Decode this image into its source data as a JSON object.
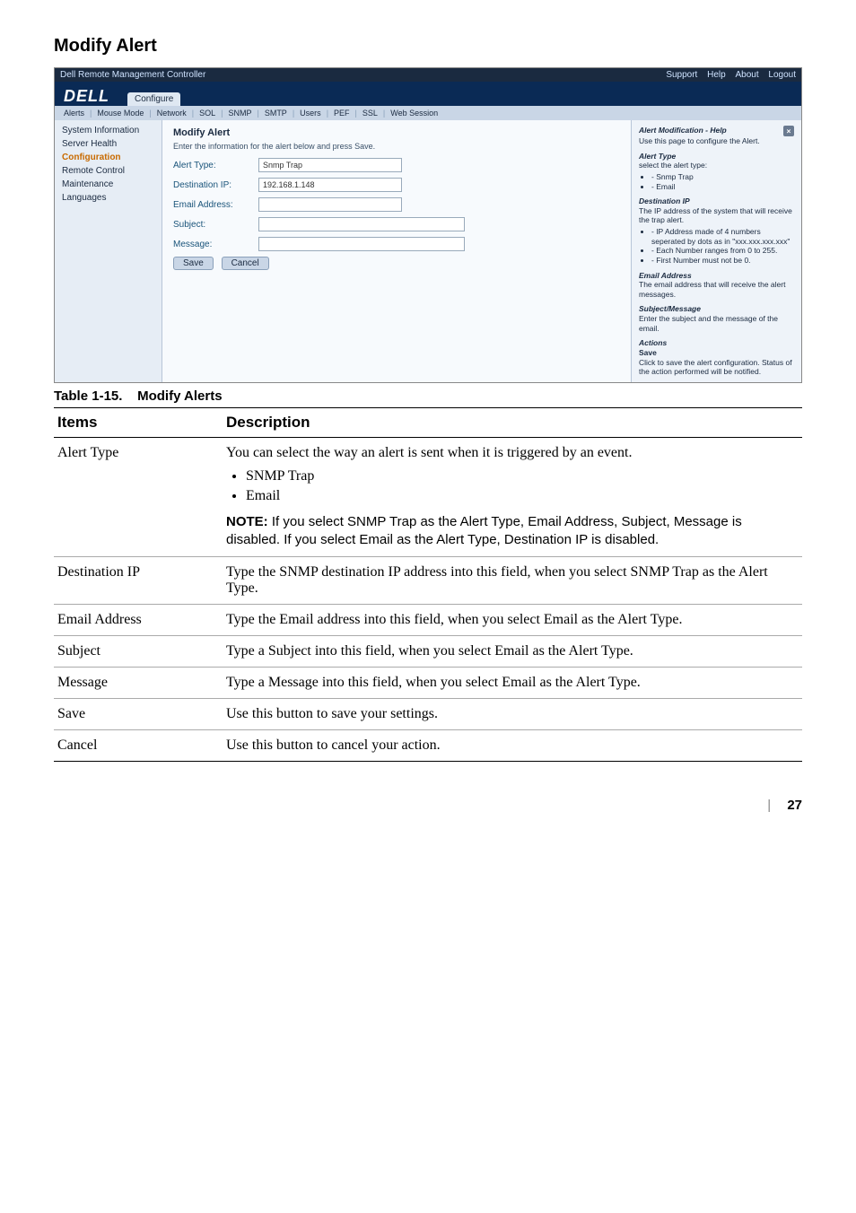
{
  "page": {
    "section_title": "Modify Alert",
    "table_caption_prefix": "Table 1-15.",
    "table_caption_title": "Modify Alerts",
    "page_number": "27",
    "footer_sep": "|"
  },
  "shot": {
    "titlebar": {
      "left": "Dell Remote Management Controller",
      "links": [
        "Support",
        "Help",
        "About",
        "Logout"
      ]
    },
    "brand": "DELL",
    "tabs": [
      "Configure"
    ],
    "subtabs": [
      "Alerts",
      "Mouse Mode",
      "Network",
      "SOL",
      "SNMP",
      "SMTP",
      "Users",
      "PEF",
      "SSL",
      "Web Session"
    ],
    "sidebar": {
      "items": [
        "System Information",
        "Server Health",
        "Configuration",
        "Remote Control",
        "Maintenance",
        "Languages"
      ],
      "selected_index": 2
    },
    "form": {
      "title": "Modify Alert",
      "hint": "Enter the information for the alert below and press Save.",
      "rows": [
        {
          "label": "Alert Type:",
          "value": "Snmp Trap",
          "type": "select"
        },
        {
          "label": "Destination IP:",
          "value": "192.168.1.148",
          "type": "text"
        },
        {
          "label": "Email Address:",
          "value": "",
          "type": "text"
        },
        {
          "label": "Subject:",
          "value": "",
          "type": "text"
        },
        {
          "label": "Message:",
          "value": "",
          "type": "text"
        }
      ],
      "buttons": {
        "save": "Save",
        "cancel": "Cancel"
      }
    },
    "help": {
      "title": "Alert Modification - Help",
      "intro": "Use this page to configure the Alert.",
      "alert_type_heading": "Alert Type",
      "alert_type_text": "select the alert type:",
      "alert_type_items": [
        "- Snmp Trap",
        "- Email"
      ],
      "dest_heading": "Destination IP",
      "dest_text": "The IP address of the system that will receive the trap alert.",
      "dest_items": [
        "- IP Address made of 4 numbers seperated by dots as in \"xxx.xxx.xxx.xxx\"",
        "- Each Number ranges from 0 to 255.",
        "- First Number must not be 0."
      ],
      "email_heading": "Email Address",
      "email_text": "The email address that will receive the alert messages.",
      "subj_heading": "Subject/Message",
      "subj_text": "Enter the subject and the message of the email.",
      "actions_heading": "Actions",
      "save_label": "Save",
      "save_text": "Click to save the alert configuration. Status of the action performed will be notified."
    }
  },
  "table": {
    "head": {
      "items": "Items",
      "desc": "Description"
    },
    "rows": [
      {
        "item": "Alert Type",
        "desc_lead": "You can select the way an alert is sent when it is triggered by an event.",
        "bullets": [
          "SNMP Trap",
          "Email"
        ],
        "note": "If you select SNMP Trap as the Alert Type, Email Address, Subject, Message is disabled. If you select Email as the Alert Type, Destination IP is disabled.",
        "note_prefix": "NOTE:"
      },
      {
        "item": "Destination IP",
        "desc": "Type the SNMP destination IP address into this field, when you select SNMP Trap as the Alert Type."
      },
      {
        "item": "Email Address",
        "desc": "Type the Email address into this field, when you select Email as the Alert Type."
      },
      {
        "item": "Subject",
        "desc": "Type a Subject into this field, when you select Email as the Alert Type."
      },
      {
        "item": "Message",
        "desc": "Type a Message into this field, when you select Email as the Alert Type."
      },
      {
        "item": "Save",
        "desc": "Use this button to save your settings."
      },
      {
        "item": "Cancel",
        "desc": "Use this button to cancel your action."
      }
    ]
  }
}
